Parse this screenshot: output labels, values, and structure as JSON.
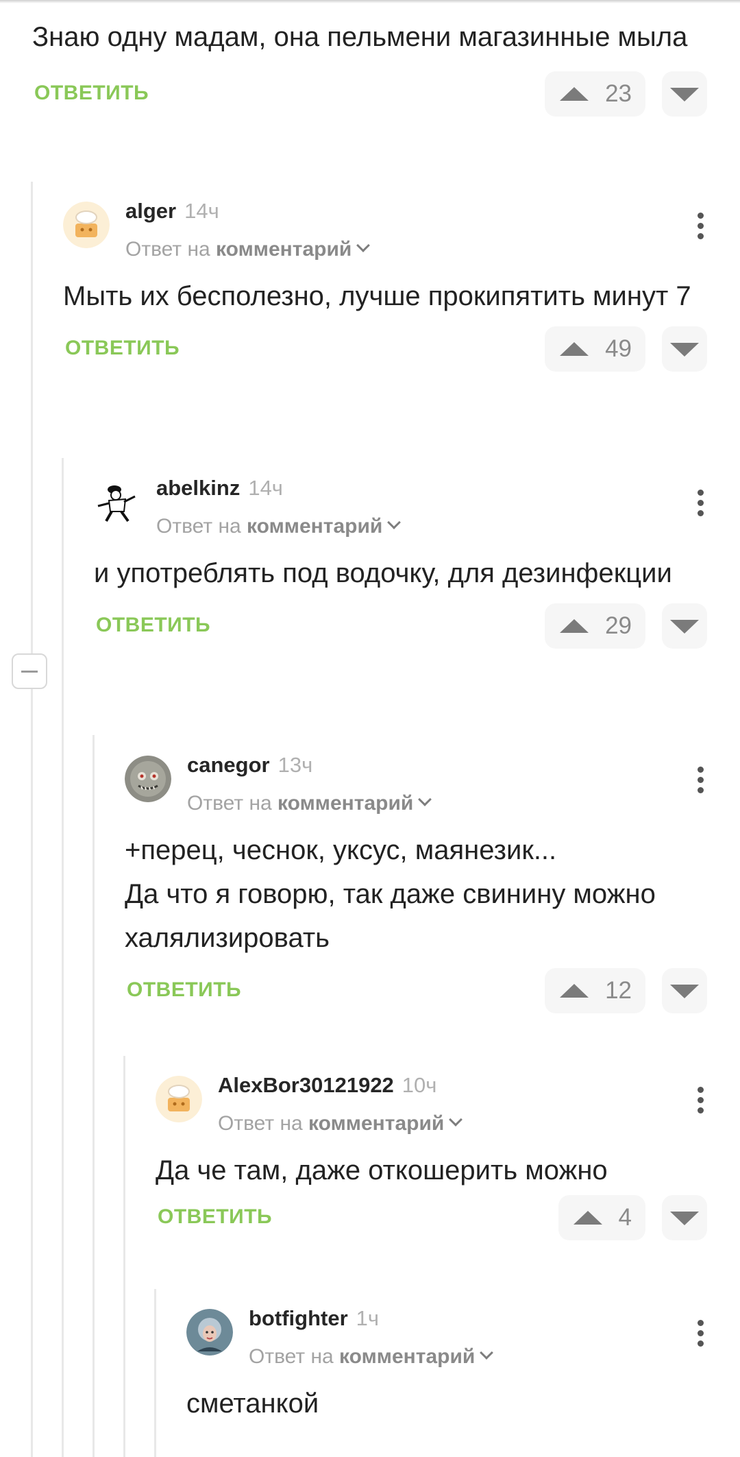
{
  "reply_label": "ОТВЕТИТЬ",
  "reply_prefix": "Ответ на",
  "reply_target": "комментарий",
  "accent_color": "#8ac858",
  "top_comment": {
    "text": "Знаю одну мадам, она пельмени магазинные мыла",
    "votes": "23"
  },
  "comments": [
    {
      "user": "alger",
      "time": "14ч",
      "text": "Мыть их бесполезно, лучше прокипятить минут 7",
      "votes": "49",
      "avatar": "default-avatar"
    },
    {
      "user": "abelkinz",
      "time": "14ч",
      "text": "и употреблять под водочку, для дезинфекции",
      "votes": "29",
      "avatar": "cartoon-avatar"
    },
    {
      "user": "canegor",
      "time": "13ч",
      "text": "+перец, чеснок, уксус, маянезик...\nДа что я говорю, так даже свинину можно халялизировать",
      "votes": "12",
      "avatar": "creature-avatar"
    },
    {
      "user": "AlexBor30121922",
      "time": "10ч",
      "text": "Да че там, даже откошерить можно",
      "votes": "4",
      "avatar": "default-avatar"
    },
    {
      "user": "botfighter",
      "time": "1ч",
      "text": "сметанкой",
      "votes": "",
      "avatar": "photo-avatar"
    }
  ]
}
